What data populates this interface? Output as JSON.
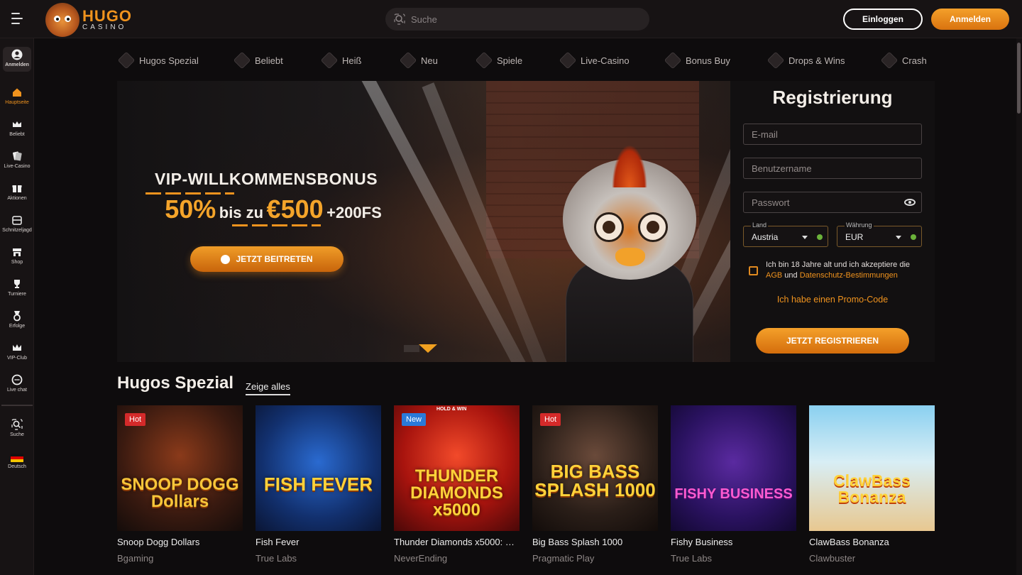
{
  "header": {
    "logo_hugo": "HUGO",
    "logo_casino": "CASINO",
    "search_placeholder": "Suche",
    "login_label": "Einloggen",
    "signup_label": "Anmelden"
  },
  "sidebar": {
    "login": "Anmelden",
    "items": [
      {
        "label": "Hauptseite",
        "icon": "home-icon"
      },
      {
        "label": "Beliebt",
        "icon": "crown-icon"
      },
      {
        "label": "Live-Casino",
        "icon": "cards-icon"
      },
      {
        "label": "Aktionen",
        "icon": "gift-icon"
      },
      {
        "label": "Schnitzeljagd",
        "icon": "chest-icon"
      },
      {
        "label": "Shop",
        "icon": "shop-icon"
      },
      {
        "label": "Turniere",
        "icon": "trophy-icon"
      },
      {
        "label": "Erfolge",
        "icon": "medal-icon"
      },
      {
        "label": "VIP-Club",
        "icon": "vip-crown-icon"
      },
      {
        "label": "Live chat",
        "icon": "chat-icon"
      }
    ],
    "search": "Suche",
    "language": "Deutsch"
  },
  "categories": [
    "Hugos Spezial",
    "Beliebt",
    "Heiß",
    "Neu",
    "Spiele",
    "Live-Casino",
    "Bonus Buy",
    "Drops & Wins",
    "Crash"
  ],
  "banner": {
    "title": "VIP-WILLKOMMENSBONUS",
    "percent": "50%",
    "mid": "bis zu",
    "amount": "€500",
    "extra": "+200FS",
    "cta": "JETZT BEITRETEN"
  },
  "registration": {
    "title": "Registrierung",
    "email_placeholder": "E-mail",
    "username_placeholder": "Benutzername",
    "password_placeholder": "Passwort",
    "country_caption": "Land",
    "country_value": "Austria",
    "currency_caption": "Währung",
    "currency_value": "EUR",
    "terms_text": "Ich bin 18 Jahre alt und ich akzeptiere die",
    "terms_link1": "AGB",
    "terms_and": "und",
    "terms_link2": "Datenschutz-Bestimmungen",
    "promo": "Ich habe einen Promo-Code",
    "submit": "JETZT REGISTRIEREN"
  },
  "section": {
    "title": "Hugos Spezial",
    "show_all": "Zeige alles"
  },
  "games": [
    {
      "name": "Snoop Dogg Dollars",
      "provider": "Bgaming",
      "badge": "Hot",
      "art": "SNOOP DOGG Dollars"
    },
    {
      "name": "Fish Fever",
      "provider": "True Labs",
      "badge": "",
      "art": "FISH FEVER"
    },
    {
      "name": "Thunder Diamonds x5000: Ho...",
      "provider": "NeverEnding",
      "badge": "New",
      "art": "THUNDER DIAMONDS x5000"
    },
    {
      "name": "Big Bass Splash 1000",
      "provider": "Pragmatic Play",
      "badge": "Hot",
      "art": "BIG BASS SPLASH 1000"
    },
    {
      "name": "Fishy Business",
      "provider": "True Labs",
      "badge": "",
      "art": "FISHY BUSINESS"
    },
    {
      "name": "ClawBass Bonanza",
      "provider": "Clawbuster",
      "badge": "",
      "art": "ClawBass Bonanza"
    }
  ],
  "thunder_tag": "HOLD & WIN",
  "colors": {
    "accent": "#f0931e",
    "background": "#0e0c0d",
    "panel": "#171314"
  }
}
